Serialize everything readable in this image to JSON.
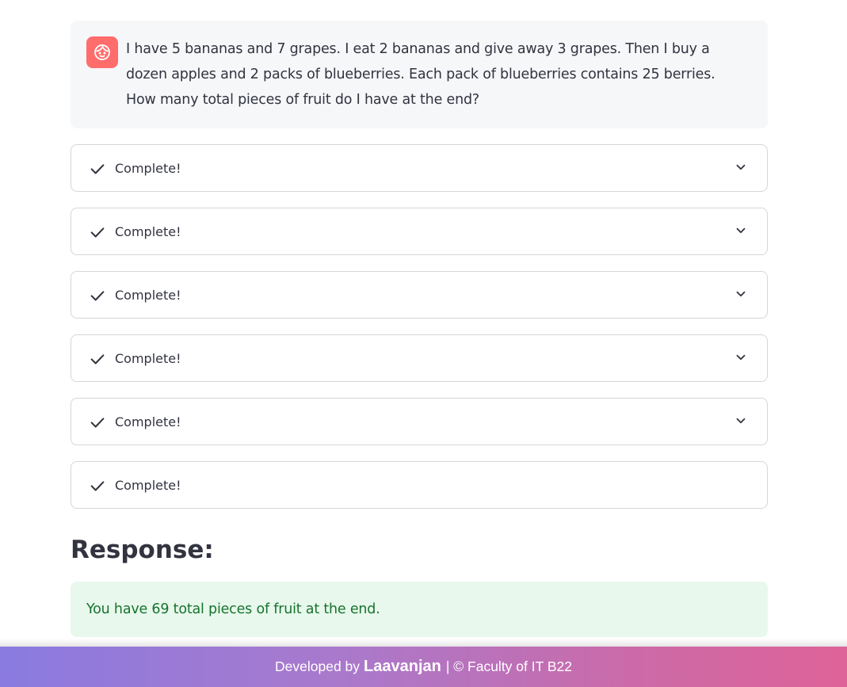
{
  "user_message": {
    "avatar_icon": "face-icon",
    "avatar_color": "#ff6c6c",
    "text": "I have 5 bananas and 7 grapes. I eat 2 bananas and give away 3 grapes. Then I buy a dozen apples and 2 packs of blueberries. Each pack of blueberries contains 25 berries. How many total pieces of fruit do I have at the end?"
  },
  "status_expanders": [
    {
      "label": "Complete!",
      "icon": "check-icon",
      "expandable": true
    },
    {
      "label": "Complete!",
      "icon": "check-icon",
      "expandable": true
    },
    {
      "label": "Complete!",
      "icon": "check-icon",
      "expandable": true
    },
    {
      "label": "Complete!",
      "icon": "check-icon",
      "expandable": true
    },
    {
      "label": "Complete!",
      "icon": "check-icon",
      "expandable": true
    },
    {
      "label": "Complete!",
      "icon": "check-icon",
      "expandable": false
    }
  ],
  "response": {
    "heading": "Response:",
    "text": "You have 69 total pieces of fruit at the end.",
    "background_color": "#e8f8ec",
    "text_color": "#17732f"
  },
  "footer": {
    "prefix": "Developed by",
    "author": "Laavanjan",
    "suffix": "| © Faculty of IT B22"
  }
}
